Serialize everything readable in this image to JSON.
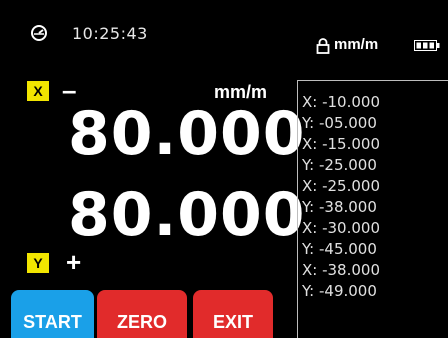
{
  "header": {
    "time": "10:25:43",
    "unit": "mm/m"
  },
  "axes": {
    "x": {
      "label": "X",
      "sign": "–",
      "value": "80.000"
    },
    "y": {
      "label": "Y",
      "sign": "+",
      "value": "80.000"
    },
    "unit": "mm/m"
  },
  "log": [
    "X: -10.000",
    "Y: -05.000",
    "X: -15.000",
    "Y: -25.000",
    "X: -25.000",
    "Y: -38.000",
    "X: -30.000",
    "Y: -45.000",
    "X: -38.000",
    "Y: -49.000"
  ],
  "buttons": {
    "start": "START",
    "zero": "ZERO",
    "exit": "EXIT"
  },
  "colors": {
    "start": "#1aa0e8",
    "zero": "#e12b2b",
    "exit": "#e12b2b",
    "badge": "#f2e500"
  },
  "icons": {
    "header_left": "gauge-icon",
    "lock": "lock-icon",
    "battery": "battery-icon"
  }
}
